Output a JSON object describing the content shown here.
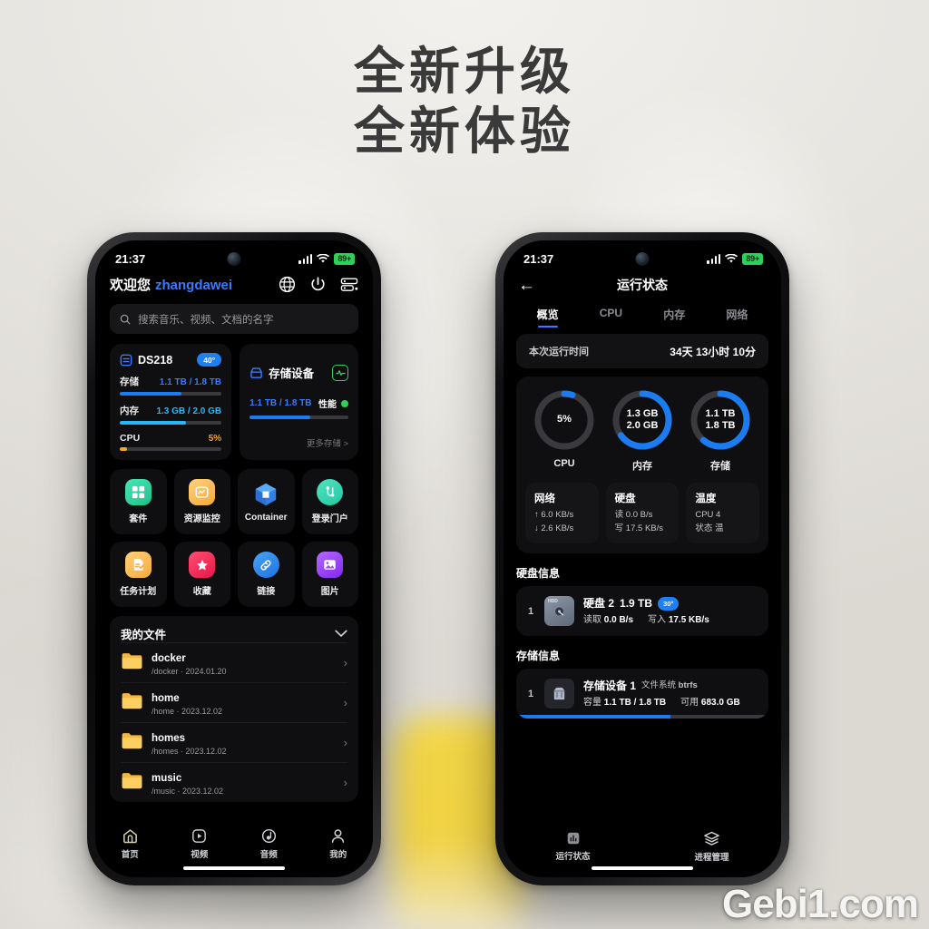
{
  "headline": {
    "line1": "全新升级",
    "line2": "全新体验"
  },
  "watermark": "Gebi1.com",
  "status_bar": {
    "time": "21:37",
    "battery": "89+"
  },
  "left_phone": {
    "header": {
      "welcome": "欢迎您",
      "user": "zhangdawei"
    },
    "header_icons": [
      "network-icon",
      "power-icon",
      "server-icon"
    ],
    "search": {
      "placeholder": "搜索音乐、视频、文档的名字"
    },
    "nas_card": {
      "name": "DS218",
      "temperature": "40°",
      "metrics": [
        {
          "label": "存储",
          "value": "1.1 TB / 1.8 TB",
          "percent": 61,
          "color": "#1a7cf0"
        },
        {
          "label": "内存",
          "value": "1.3 GB / 2.0 GB",
          "percent": 65,
          "color": "#29b6f6"
        },
        {
          "label": "CPU",
          "value": "5%",
          "percent": 5,
          "color": "#f5a623"
        }
      ]
    },
    "storage_card": {
      "title": "存储设备",
      "capacity": "1.1 TB / 1.8 TB",
      "perf_label": "性能",
      "percent": 61,
      "more": "更多存储 >"
    },
    "apps": [
      {
        "label": "套件",
        "icon": "suite-icon",
        "color": "#2fd7a0"
      },
      {
        "label": "资源监控",
        "icon": "monitor-icon",
        "color": "#f7c35c"
      },
      {
        "label": "Container",
        "icon": "container-icon",
        "color": "#3a8ef0"
      },
      {
        "label": "登录门户",
        "icon": "portal-icon",
        "color": "#3dd6b0"
      },
      {
        "label": "任务计划",
        "icon": "task-icon",
        "color": "#f7b85c"
      },
      {
        "label": "收藏",
        "icon": "star-icon",
        "color": "#f2345a"
      },
      {
        "label": "链接",
        "icon": "link-icon",
        "color": "#2f8ef0"
      },
      {
        "label": "图片",
        "icon": "photo-icon",
        "color": "#9a4ff5"
      }
    ],
    "files": {
      "title": "我的文件",
      "items": [
        {
          "name": "docker",
          "path": "/docker · 2024.01.20"
        },
        {
          "name": "home",
          "path": "/home · 2023.12.02"
        },
        {
          "name": "homes",
          "path": "/homes · 2023.12.02"
        },
        {
          "name": "music",
          "path": "/music · 2023.12.02"
        }
      ]
    },
    "tabbar": [
      {
        "label": "首页",
        "icon": "home-icon",
        "active": true
      },
      {
        "label": "视频",
        "icon": "video-icon",
        "active": false
      },
      {
        "label": "音频",
        "icon": "audio-icon",
        "active": false
      },
      {
        "label": "我的",
        "icon": "user-icon",
        "active": false
      }
    ]
  },
  "right_phone": {
    "title": "运行状态",
    "tabs": [
      "概览",
      "CPU",
      "内存",
      "网络"
    ],
    "active_tab": "概览",
    "uptime": {
      "label": "本次运行时间",
      "value": "34天 13小时 10分"
    },
    "gauges": [
      {
        "label": "CPU",
        "line1": "5%",
        "line2": "",
        "percent": 5
      },
      {
        "label": "内存",
        "line1": "1.3 GB",
        "line2": "2.0 GB",
        "percent": 65
      },
      {
        "label": "存储",
        "line1": "1.1 TB",
        "line2": "1.8 TB",
        "percent": 61
      }
    ],
    "mini_cards": [
      {
        "title": "网络",
        "line1": "↑ 6.0 KB/s",
        "line2": "↓ 2.6 KB/s"
      },
      {
        "title": "硬盘",
        "line1": "读 0.0 B/s",
        "line2": "写 17.5 KB/s"
      },
      {
        "title": "温度",
        "line1": "CPU 4",
        "line2": "状态 温"
      }
    ],
    "disk_section": {
      "title": "硬盘信息",
      "index": "1",
      "name": "硬盘 2",
      "size": "1.9 TB",
      "temperature": "30°",
      "read_label": "读取",
      "read_value": "0.0 B/s",
      "write_label": "写入",
      "write_value": "17.5 KB/s"
    },
    "storage_section": {
      "title": "存储信息",
      "index": "1",
      "name": "存储设备 1",
      "fs_label": "文件系统",
      "fs_value": "btrfs",
      "cap_label": "容量",
      "cap_value": "1.1 TB / 1.8 TB",
      "free_label": "可用",
      "free_value": "683.0 GB",
      "percent": 61
    },
    "tabbar": [
      {
        "label": "运行状态",
        "icon": "chart-icon",
        "active": true
      },
      {
        "label": "进程管理",
        "icon": "layers-icon",
        "active": false
      }
    ]
  },
  "colors": {
    "accent": "#3a7afe",
    "blue": "#1a7cf0",
    "cyan": "#29b6f6",
    "orange": "#f5a623",
    "green": "#2ed158"
  }
}
